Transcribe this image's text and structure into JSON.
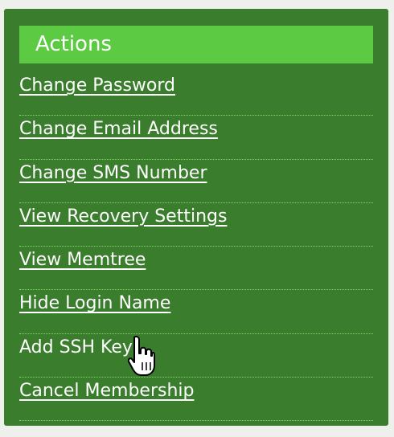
{
  "panel": {
    "title": "Actions"
  },
  "actions": [
    {
      "label": "Change Password",
      "state": "normal"
    },
    {
      "label": "Change Email Address",
      "state": "normal"
    },
    {
      "label": "Change SMS Number",
      "state": "normal"
    },
    {
      "label": "View Recovery Settings",
      "state": "normal"
    },
    {
      "label": "View Memtree",
      "state": "normal"
    },
    {
      "label": "Hide Login Name",
      "state": "normal"
    },
    {
      "label": "Add SSH Key",
      "state": "hovered"
    },
    {
      "label": "Cancel Membership",
      "state": "normal"
    }
  ],
  "colors": {
    "panel_background": "#3a7d2c",
    "header_background": "#5ccb43",
    "link_text": "#ffffff",
    "divider": "#7ed86a",
    "page_background": "#eef0ec"
  },
  "cursor": {
    "icon": "hand-pointer-icon"
  }
}
